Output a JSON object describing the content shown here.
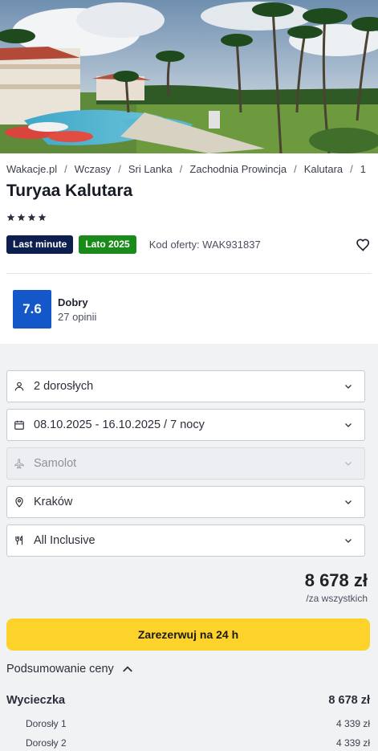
{
  "breadcrumb": [
    "Wakacje.pl",
    "Wczasy",
    "Sri Lanka",
    "Zachodnia Prowincja",
    "Kalutara",
    "1"
  ],
  "hotel": {
    "name": "Turyaa Kalutara",
    "stars": 4,
    "badge_last_minute": "Last minute",
    "badge_season": "Lato 2025",
    "offer_code": "Kod oferty: WAK931837"
  },
  "rating": {
    "score": "7.6",
    "label": "Dobry",
    "reviews": "27 opinii"
  },
  "form": {
    "travelers": "2 dorosłych",
    "dates": "08.10.2025 - 16.10.2025 / 7 nocy",
    "transport": "Samolot",
    "departure": "Kraków",
    "board": "All Inclusive"
  },
  "pricing": {
    "total": "8 678 zł",
    "note": "/za wszystkich",
    "reserve_label": "Zarezerwuj na 24 h",
    "summary_toggle": "Podsumowanie ceny",
    "trip_label": "Wycieczka",
    "trip_price": "8 678 zł",
    "persons": [
      {
        "label": "Dorosły 1",
        "price": "4 339 zł"
      },
      {
        "label": "Dorosły 2",
        "price": "4 339 zł"
      }
    ]
  },
  "colors": {
    "last_minute": "#0c1f4f",
    "season": "#1a8a1a",
    "score": "#1457c8",
    "reserve_button": "#fdd22a"
  }
}
